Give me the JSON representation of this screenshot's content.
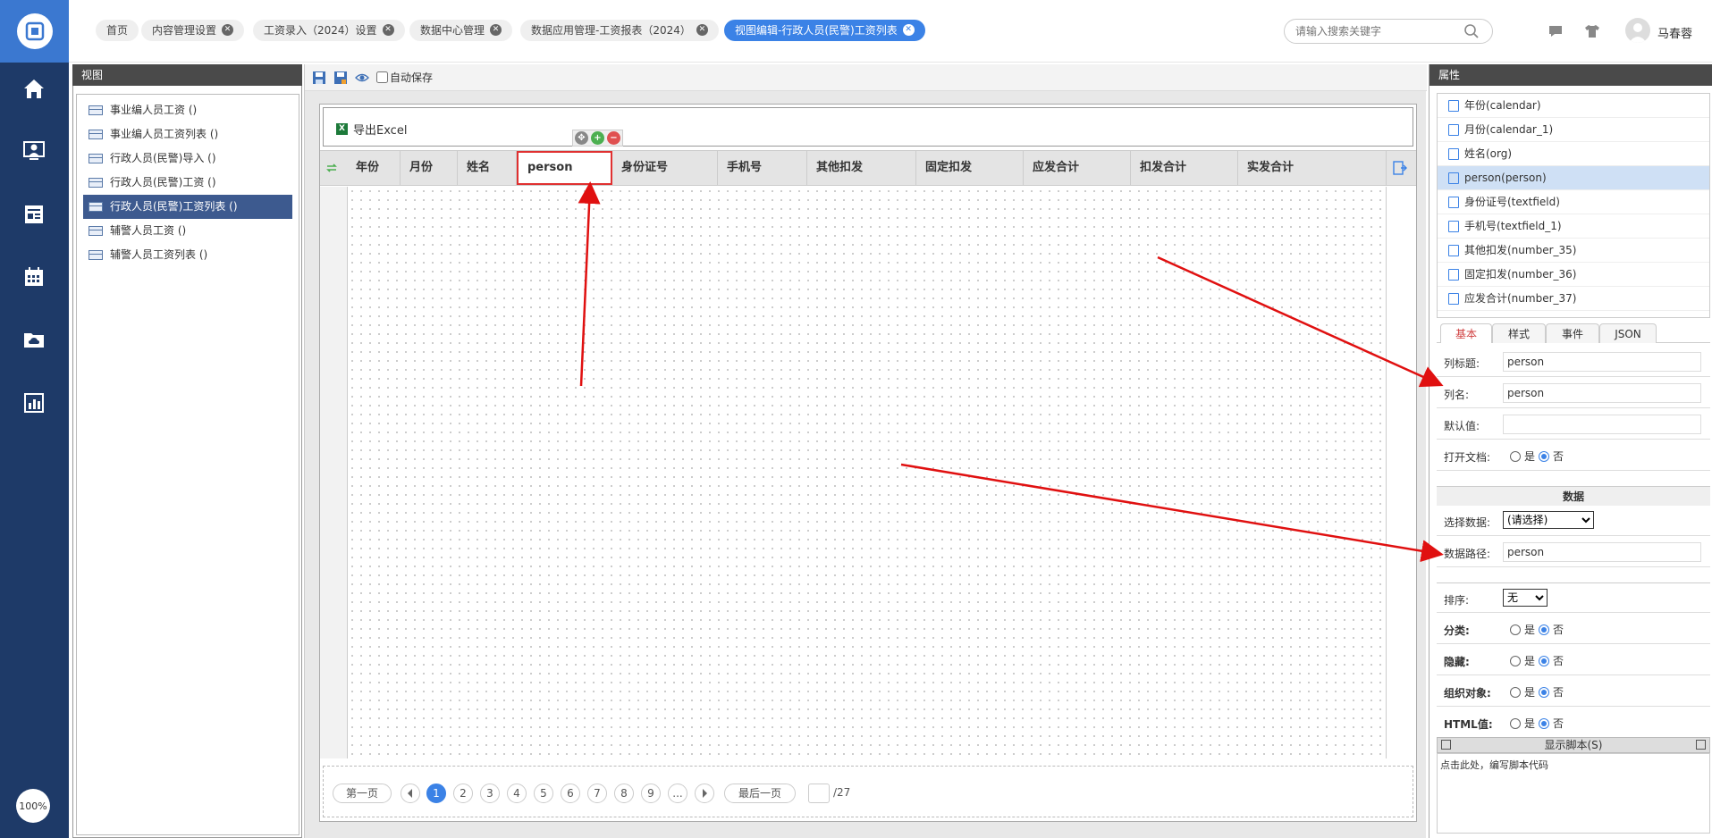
{
  "nav": {
    "zoom": "100%"
  },
  "tabs": [
    {
      "label": "首页",
      "closable": false
    },
    {
      "label": "内容管理设置",
      "closable": true
    },
    {
      "label": "工资录入（2024）设置",
      "closable": true
    },
    {
      "label": "数据中心管理",
      "closable": true
    },
    {
      "label": "数据应用管理-工资报表（2024）",
      "closable": true
    },
    {
      "label": "视图编辑-行政人员(民警)工资列表",
      "closable": true,
      "active": true
    }
  ],
  "search": {
    "placeholder": "请输入搜索关键字"
  },
  "user": {
    "name": "马春蓉"
  },
  "view_panel": {
    "title": "视图",
    "items": [
      "事业编人员工资 ()",
      "事业编人员工资列表 ()",
      "行政人员(民警)导入 ()",
      "行政人员(民警)工资 ()",
      "行政人员(民警)工资列表 ()",
      "辅警人员工资 ()",
      "辅警人员工资列表 ()"
    ],
    "selected_index": 4
  },
  "toolbar": {
    "autosave_label": "自动保存"
  },
  "canvas": {
    "export_label": "导出Excel",
    "columns": [
      "年份",
      "月份",
      "姓名",
      "person",
      "身份证号",
      "手机号",
      "其他扣发",
      "固定扣发",
      "应发合计",
      "扣发合计",
      "实发合计"
    ],
    "selected_column": "person"
  },
  "pager": {
    "first": "第一页",
    "pages": [
      "1",
      "2",
      "3",
      "4",
      "5",
      "6",
      "7",
      "8",
      "9",
      "..."
    ],
    "current": "1",
    "last": "最后一页",
    "total": "/27"
  },
  "properties": {
    "title": "属性",
    "fields": [
      "年份(calendar)",
      "月份(calendar_1)",
      "姓名(org)",
      "person(person)",
      "身份证号(textfield)",
      "手机号(textfield_1)",
      "其他扣发(number_35)",
      "固定扣发(number_36)",
      "应发合计(number_37)"
    ],
    "selected_field_index": 3,
    "tabs": [
      "基本",
      "样式",
      "事件",
      "JSON"
    ],
    "column_title_label": "列标题:",
    "column_title_value": "person",
    "column_name_label": "列名:",
    "column_name_value": "person",
    "default_label": "默认值:",
    "default_value": "",
    "open_doc_label": "打开文档:",
    "yes": "是",
    "no": "否",
    "data_section": "数据",
    "select_data_label": "选择数据:",
    "select_data_value": "(请选择)",
    "data_path_label": "数据路径:",
    "data_path_value": "person",
    "sort_label": "排序:",
    "sort_value": "无",
    "category_label": "分类:",
    "hidden_label": "隐藏:",
    "org_label": "组织对象:",
    "html_label": "HTML值:",
    "script_head": "显示脚本(S)",
    "script_hint": "点击此处，编写脚本代码"
  },
  "colors": {
    "nav_bg": "#1e3a68",
    "accent": "#3b82e6",
    "selection_border": "#e03030"
  }
}
